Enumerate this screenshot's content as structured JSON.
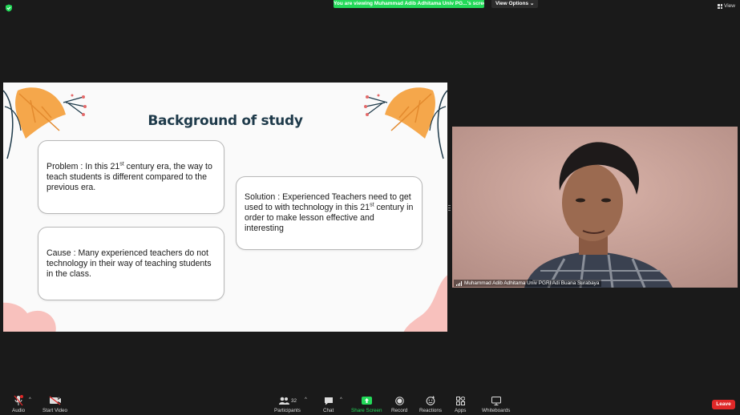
{
  "top_bar": {
    "viewing_banner": "You are viewing Muhammad Adib Adhitama Univ PG...'s screen",
    "view_options_label": "View Options",
    "view_label": "View"
  },
  "slide": {
    "title": "Background of study",
    "problem": {
      "pre": "Problem : In this 21",
      "sup": "st",
      "post": " century era, the way to teach students is different compared to the previous era."
    },
    "cause": {
      "text": "Cause : Many experienced teachers do not technology in their way of teaching students in the class."
    },
    "solution": {
      "pre": "Solution : Experienced Teachers need to get used to with technology in this 21",
      "sup": "st",
      "post": " century in order to make lesson effective and interesting"
    }
  },
  "video": {
    "participant_name": "Muhammad Adib Adhitama Univ PGRI Adi Buana Surabaya"
  },
  "toolbar": {
    "audio": "Audio",
    "start_video": "Start Video",
    "participants": "Participants",
    "participants_count": "32",
    "chat": "Chat",
    "share_screen": "Share Screen",
    "record": "Record",
    "reactions": "Reactions",
    "apps": "Apps",
    "whiteboards": "Whiteboards",
    "leave": "Leave"
  },
  "colors": {
    "share_green": "#23d959",
    "leave_red": "#e02828",
    "slide_title": "#1e3a4a",
    "leaf_orange": "#f5a74b",
    "blob_pink": "#f8c1bd"
  }
}
